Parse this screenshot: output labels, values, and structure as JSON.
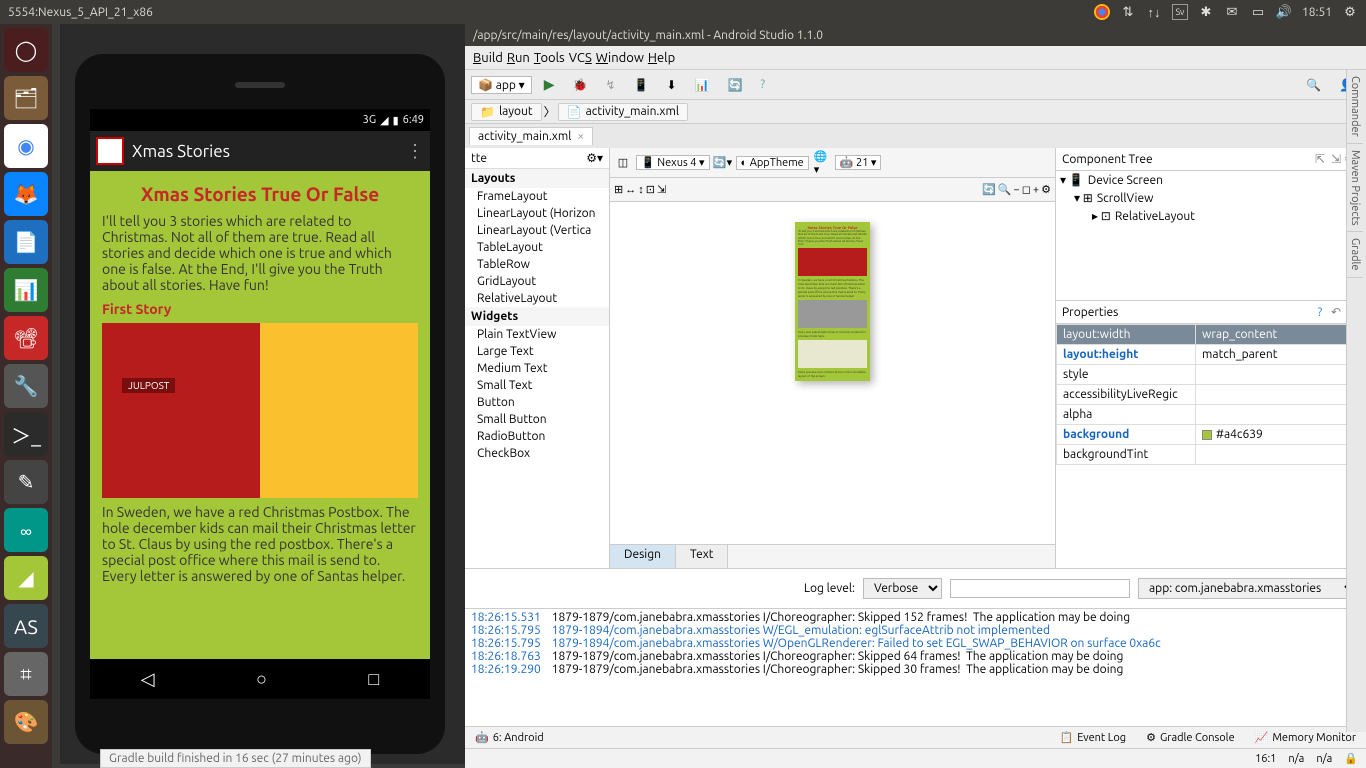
{
  "ubuntu": {
    "window_title": "5554:Nexus_5_API_21_x86",
    "time": "18:51"
  },
  "launcher_icons": [
    "dash",
    "files",
    "chrome",
    "firefox",
    "writer",
    "calc",
    "impress",
    "settings",
    "terminal",
    "editor",
    "arduino",
    "android",
    "androidstudio",
    "calc2",
    "gimp",
    "trash"
  ],
  "emulator": {
    "status_time": "6:49",
    "status_net": "3G",
    "app_title": "Xmas Stories",
    "heading": "Xmas Stories True Or False",
    "intro": "I'll tell you 3 stories which are related to Christmas. Not all of them are true. Read all stories and decide which one is true and which one is false. At the End, I'll give you the Truth about all stories. Have fun!",
    "first_story_label": "First Story",
    "first_story_text": "In Sweden, we have a red Christmas Postbox. The hole december kids can mail their Christmas letter to St. Claus by using the red postbox. There's a special post office where this mail is send to. Every letter is answered by one of Santas helper."
  },
  "studio": {
    "title": "/app/src/main/res/layout/activity_main.xml - Android Studio 1.1.0",
    "menu": [
      "Build",
      "Run",
      "Tools",
      "VCS",
      "Window",
      "Help"
    ],
    "toolbar": {
      "config": "app"
    },
    "breadcrumb": [
      "layout",
      "activity_main.xml"
    ],
    "tab": "activity_main.xml",
    "palette_title": "tte",
    "palette_groups": [
      {
        "name": "Layouts",
        "items": [
          "FrameLayout",
          "LinearLayout (Horizon",
          "LinearLayout (Vertica",
          "TableLayout",
          "TableRow",
          "GridLayout",
          "RelativeLayout"
        ]
      },
      {
        "name": "Widgets",
        "items": [
          "Plain TextView",
          "Large Text",
          "Medium Text",
          "Small Text",
          "Button",
          "Small Button",
          "RadioButton",
          "CheckBox"
        ]
      }
    ],
    "design_device": "Nexus 4",
    "design_theme": "AppTheme",
    "design_api": "21",
    "design_tabs": {
      "design": "Design",
      "text": "Text"
    },
    "tree_title": "Component Tree",
    "tree": [
      "Device Screen",
      "ScrollView",
      "RelativeLayout"
    ],
    "props_title": "Properties",
    "props": [
      {
        "k": "layout:width",
        "v": "wrap_content",
        "sel": true
      },
      {
        "k": "layout:height",
        "v": "match_parent",
        "blue": true
      },
      {
        "k": "style",
        "v": ""
      },
      {
        "k": "accessibilityLiveRegic",
        "v": ""
      },
      {
        "k": "alpha",
        "v": ""
      },
      {
        "k": "background",
        "v": "#a4c639",
        "blue": true,
        "swatch": true
      },
      {
        "k": "backgroundTint",
        "v": ""
      }
    ],
    "gutters": [
      "Commander",
      "Maven Projects",
      "Gradle"
    ],
    "loglevel_label": "Log level:",
    "loglevel": "Verbose",
    "log_filter": "app: com.janebabra.xmasstories",
    "log_search_placeholder": "",
    "log": [
      "18:26:15.531    1879-1879/com.janebabra.xmasstories I/Choreographer: Skipped 152 frames!  The application may be doing",
      "18:26:15.795    1879-1894/com.janebabra.xmasstories W/EGL_emulation: eglSurfaceAttrib not implemented",
      "18:26:15.795    1879-1894/com.janebabra.xmasstories W/OpenGLRenderer: Failed to set EGL_SWAP_BEHAVIOR on surface 0xa6c",
      "18:26:18.763    1879-1879/com.janebabra.xmasstories I/Choreographer: Skipped 64 frames!  The application may be doing",
      "18:26:19.290    1879-1879/com.janebabra.xmasstories I/Choreographer: Skipped 30 frames!  The application may be doing"
    ],
    "bottom_tab_android": "6: Android",
    "bottom_tabs_right": [
      "Event Log",
      "Gradle Console",
      "Memory Monitor"
    ],
    "status": {
      "pos": "16:1",
      "na1": "n/a",
      "na2": "n/a"
    },
    "gradle_msg": "Gradle build finished in 16 sec (27 minutes ago)"
  }
}
